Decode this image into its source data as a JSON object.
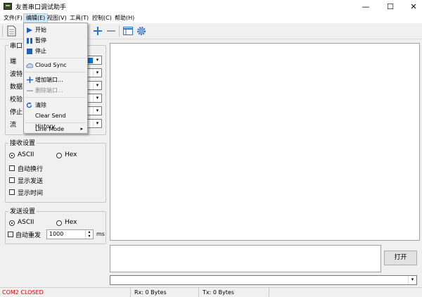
{
  "window": {
    "title": "友善串口调试助手",
    "min": "—",
    "max": "☐",
    "close": "✕"
  },
  "menubar": [
    {
      "label": "文件(F)"
    },
    {
      "label": "编辑(E)"
    },
    {
      "label": "视图(V)"
    },
    {
      "label": "工具(T)"
    },
    {
      "label": "控制(C)"
    },
    {
      "label": "帮助(H)"
    }
  ],
  "edit_menu": {
    "start": "开始",
    "pause": "暂停",
    "stop": "停止",
    "cloud_sync": "Cloud Sync",
    "add_port": "增加端口...",
    "remove_port": "删除端口...",
    "clear": "清除",
    "clear_history": "Clear Send History",
    "line_mode": "Line Mode"
  },
  "serial_group": {
    "title_partial": "串口",
    "labels": [
      "端",
      "波特",
      "数据",
      "校验",
      "停止",
      "流"
    ]
  },
  "receive": {
    "title": "接收设置",
    "ascii": "ASCII",
    "hex": "Hex",
    "options": [
      "自动换行",
      "显示发送",
      "显示时间"
    ]
  },
  "send": {
    "title": "发送设置",
    "ascii": "ASCII",
    "hex": "Hex",
    "auto_resend": "自动重发",
    "interval": "1000",
    "unit": "ms"
  },
  "open_button": "打开",
  "status": {
    "port": "COM2 CLOSED",
    "rx": "Rx: 0 Bytes",
    "tx": "Tx: 0 Bytes",
    "port_color": "#e00000"
  }
}
